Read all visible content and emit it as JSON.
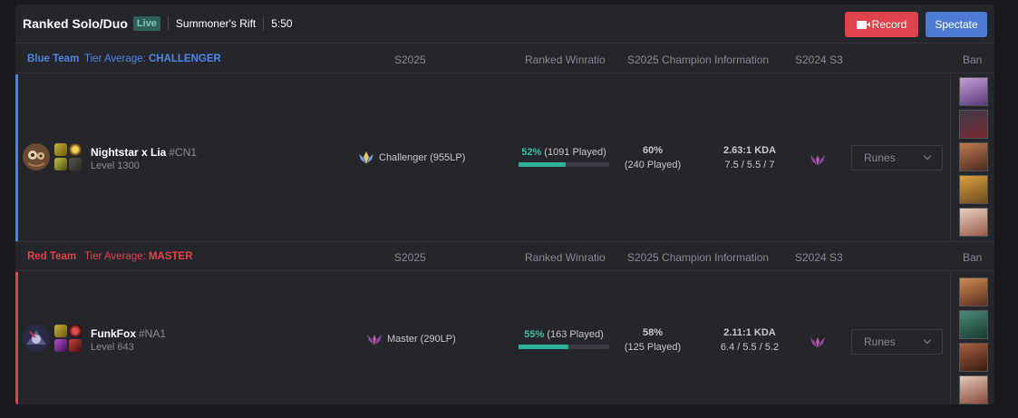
{
  "header": {
    "queue": "Ranked Solo/Duo",
    "live_badge": "Live",
    "map": "Summoner's Rift",
    "timer": "5:50",
    "record_label": "Record",
    "spectate_label": "Spectate"
  },
  "columns": {
    "season": "S2025",
    "winratio": "Ranked Winratio",
    "champ_info": "S2025 Champion Information",
    "prev_season": "S2024 S3",
    "ban": "Ban"
  },
  "teams": [
    {
      "name": "Blue Team",
      "tier_avg_label": "Tier Average:",
      "tier_avg_value": "CHALLENGER",
      "color": "#4f86e6",
      "players": [
        {
          "name": "Nightstar x Lia",
          "tag": "#CN1",
          "level": "Level 1300",
          "rank": "Challenger (955LP)",
          "winrate_pct": "52%",
          "winrate_played": "(1091 Played)",
          "winrate_value": 52,
          "champ_winrate": "60%",
          "champ_played": "(240 Played)",
          "kda_ratio": "2.63:1 KDA",
          "kda_detail": "7.5 / 5.5 / 7",
          "runes_label": "Runes"
        }
      ]
    },
    {
      "name": "Red Team",
      "tier_avg_label": "Tier Average:",
      "tier_avg_value": "MASTER",
      "color": "#e0434b",
      "players": [
        {
          "name": "FunkFox",
          "tag": "#NA1",
          "level": "Level 643",
          "rank": "Master (290LP)",
          "winrate_pct": "55%",
          "winrate_played": "(163 Played)",
          "winrate_value": 55,
          "champ_winrate": "58%",
          "champ_played": "(125 Played)",
          "kda_ratio": "2.11:1 KDA",
          "kda_detail": "6.4 / 5.5 / 5.2",
          "runes_label": "Runes"
        }
      ]
    }
  ]
}
